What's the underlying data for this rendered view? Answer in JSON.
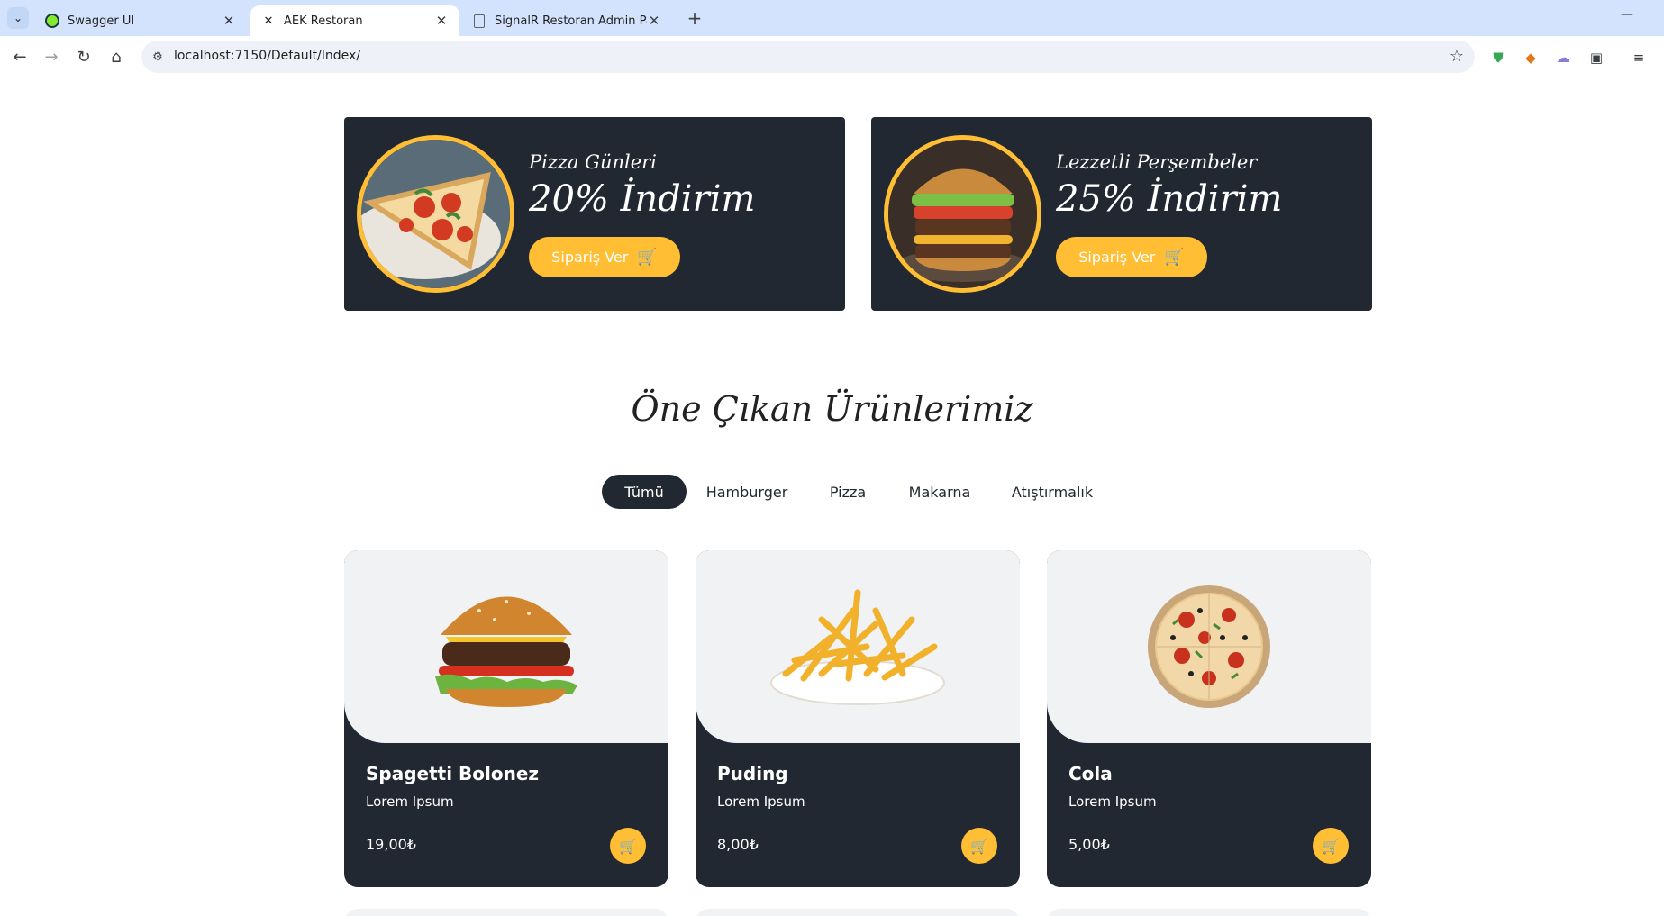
{
  "browser": {
    "tabs": [
      {
        "title": "Swagger UI",
        "icon": "swagger-icon",
        "active": false
      },
      {
        "title": "AEK Restoran",
        "icon": "cross-utensils-icon",
        "active": true
      },
      {
        "title": "SignalR Restoran Admin Paneli",
        "icon": "document-icon",
        "active": false
      }
    ],
    "url": "localhost:7150/Default/Index/"
  },
  "offers": [
    {
      "subtitle": "Pizza Günleri",
      "headline": "20% İndirim",
      "button": "Sipariş Ver",
      "image": "pizza-slice"
    },
    {
      "subtitle": "Lezzetli Perşembeler",
      "headline": "25% İndirim",
      "button": "Sipariş Ver",
      "image": "burger"
    }
  ],
  "menu": {
    "title": "Öne Çıkan Ürünlerimiz",
    "filters": [
      "Tümü",
      "Hamburger",
      "Pizza",
      "Makarna",
      "Atıştırmalık"
    ],
    "active_filter": "Tümü",
    "products": [
      {
        "name": "Spagetti Bolonez",
        "description": "Lorem Ipsum",
        "price": "19,00₺",
        "image": "burger"
      },
      {
        "name": "Puding",
        "description": "Lorem Ipsum",
        "price": "8,00₺",
        "image": "fries"
      },
      {
        "name": "Cola",
        "description": "Lorem Ipsum",
        "price": "5,00₺",
        "image": "pizza"
      }
    ]
  },
  "colors": {
    "dark": "#222831",
    "accent": "#ffbe33",
    "chrome": "#d3e3fd"
  }
}
